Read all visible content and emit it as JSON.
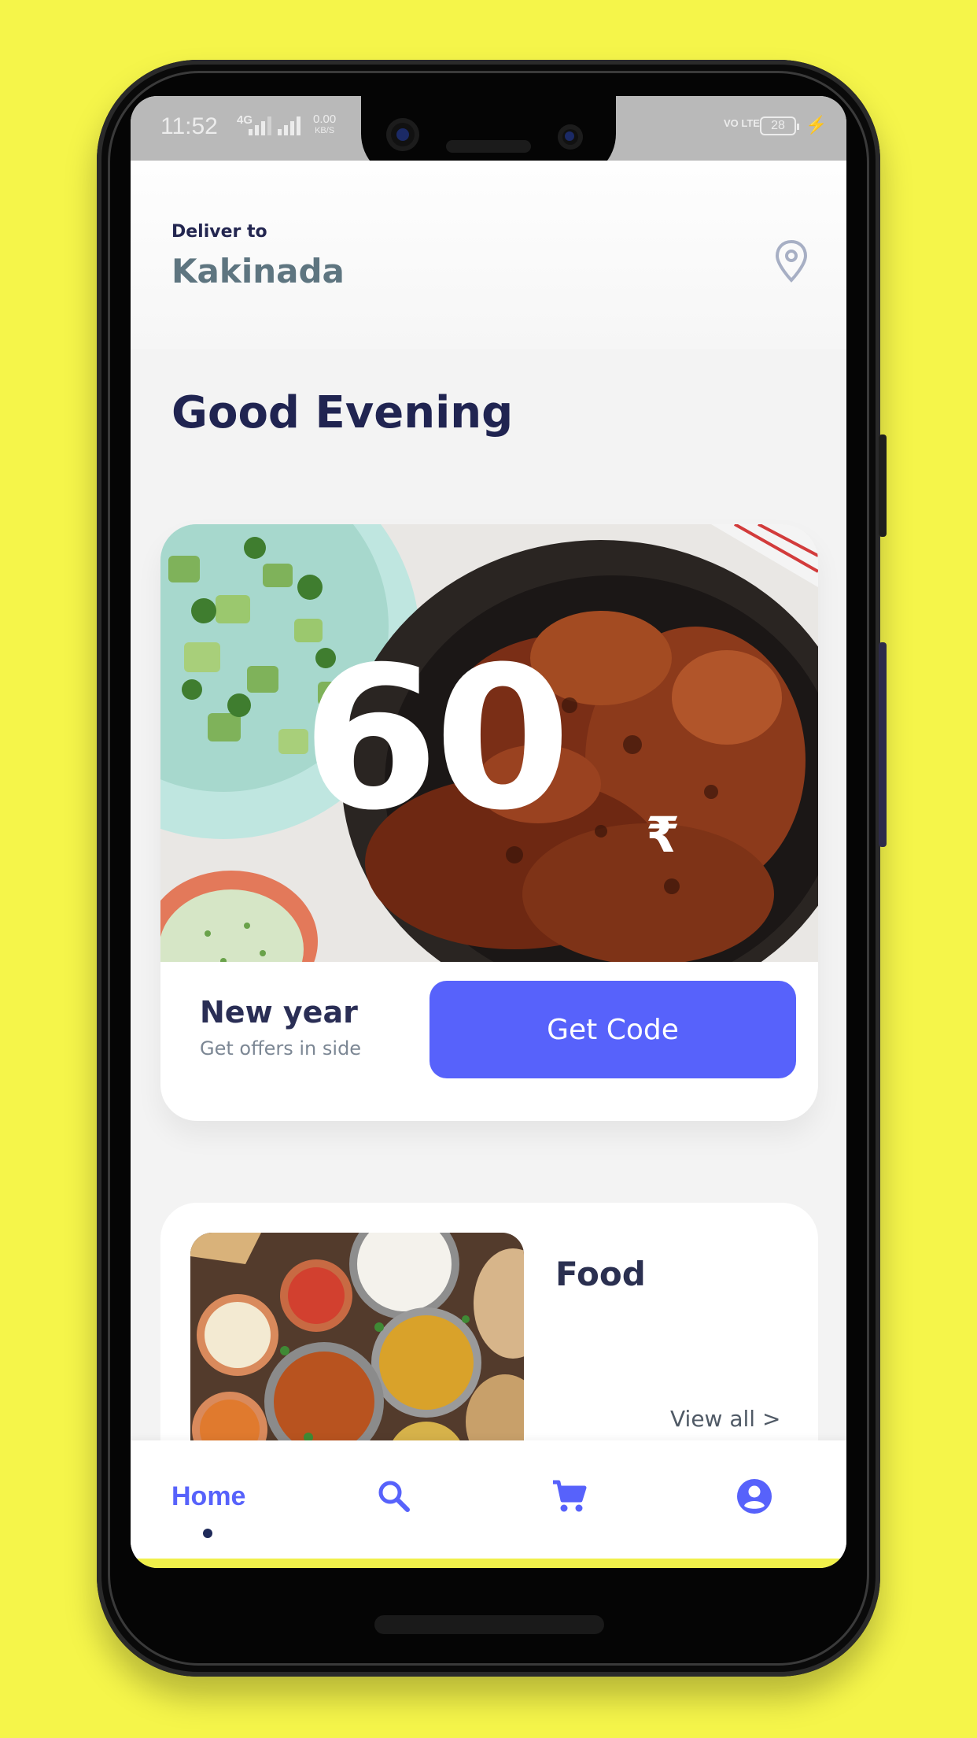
{
  "status_bar": {
    "time": "11:52",
    "network": "4G",
    "data_speed": "0.00",
    "data_unit": "KB/S",
    "volte": "VO LTE",
    "battery": "28"
  },
  "header": {
    "deliver_label": "Deliver to",
    "city": "Kakinada",
    "location_icon": "location-pin-icon"
  },
  "greeting": "Good Evening",
  "offer": {
    "amount": "60",
    "currency_symbol": "₹",
    "title": "New year",
    "subtitle": "Get offers in side",
    "button_label": "Get Code"
  },
  "category": {
    "title": "Food",
    "link_label": "View all >"
  },
  "bottom_nav": {
    "home_label": "Home",
    "items": [
      "home",
      "search-icon",
      "cart-icon",
      "account-icon"
    ]
  },
  "colors": {
    "background": "#f5f54a",
    "accent": "#5762fb",
    "heading": "#202451",
    "city": "#5e7580"
  }
}
